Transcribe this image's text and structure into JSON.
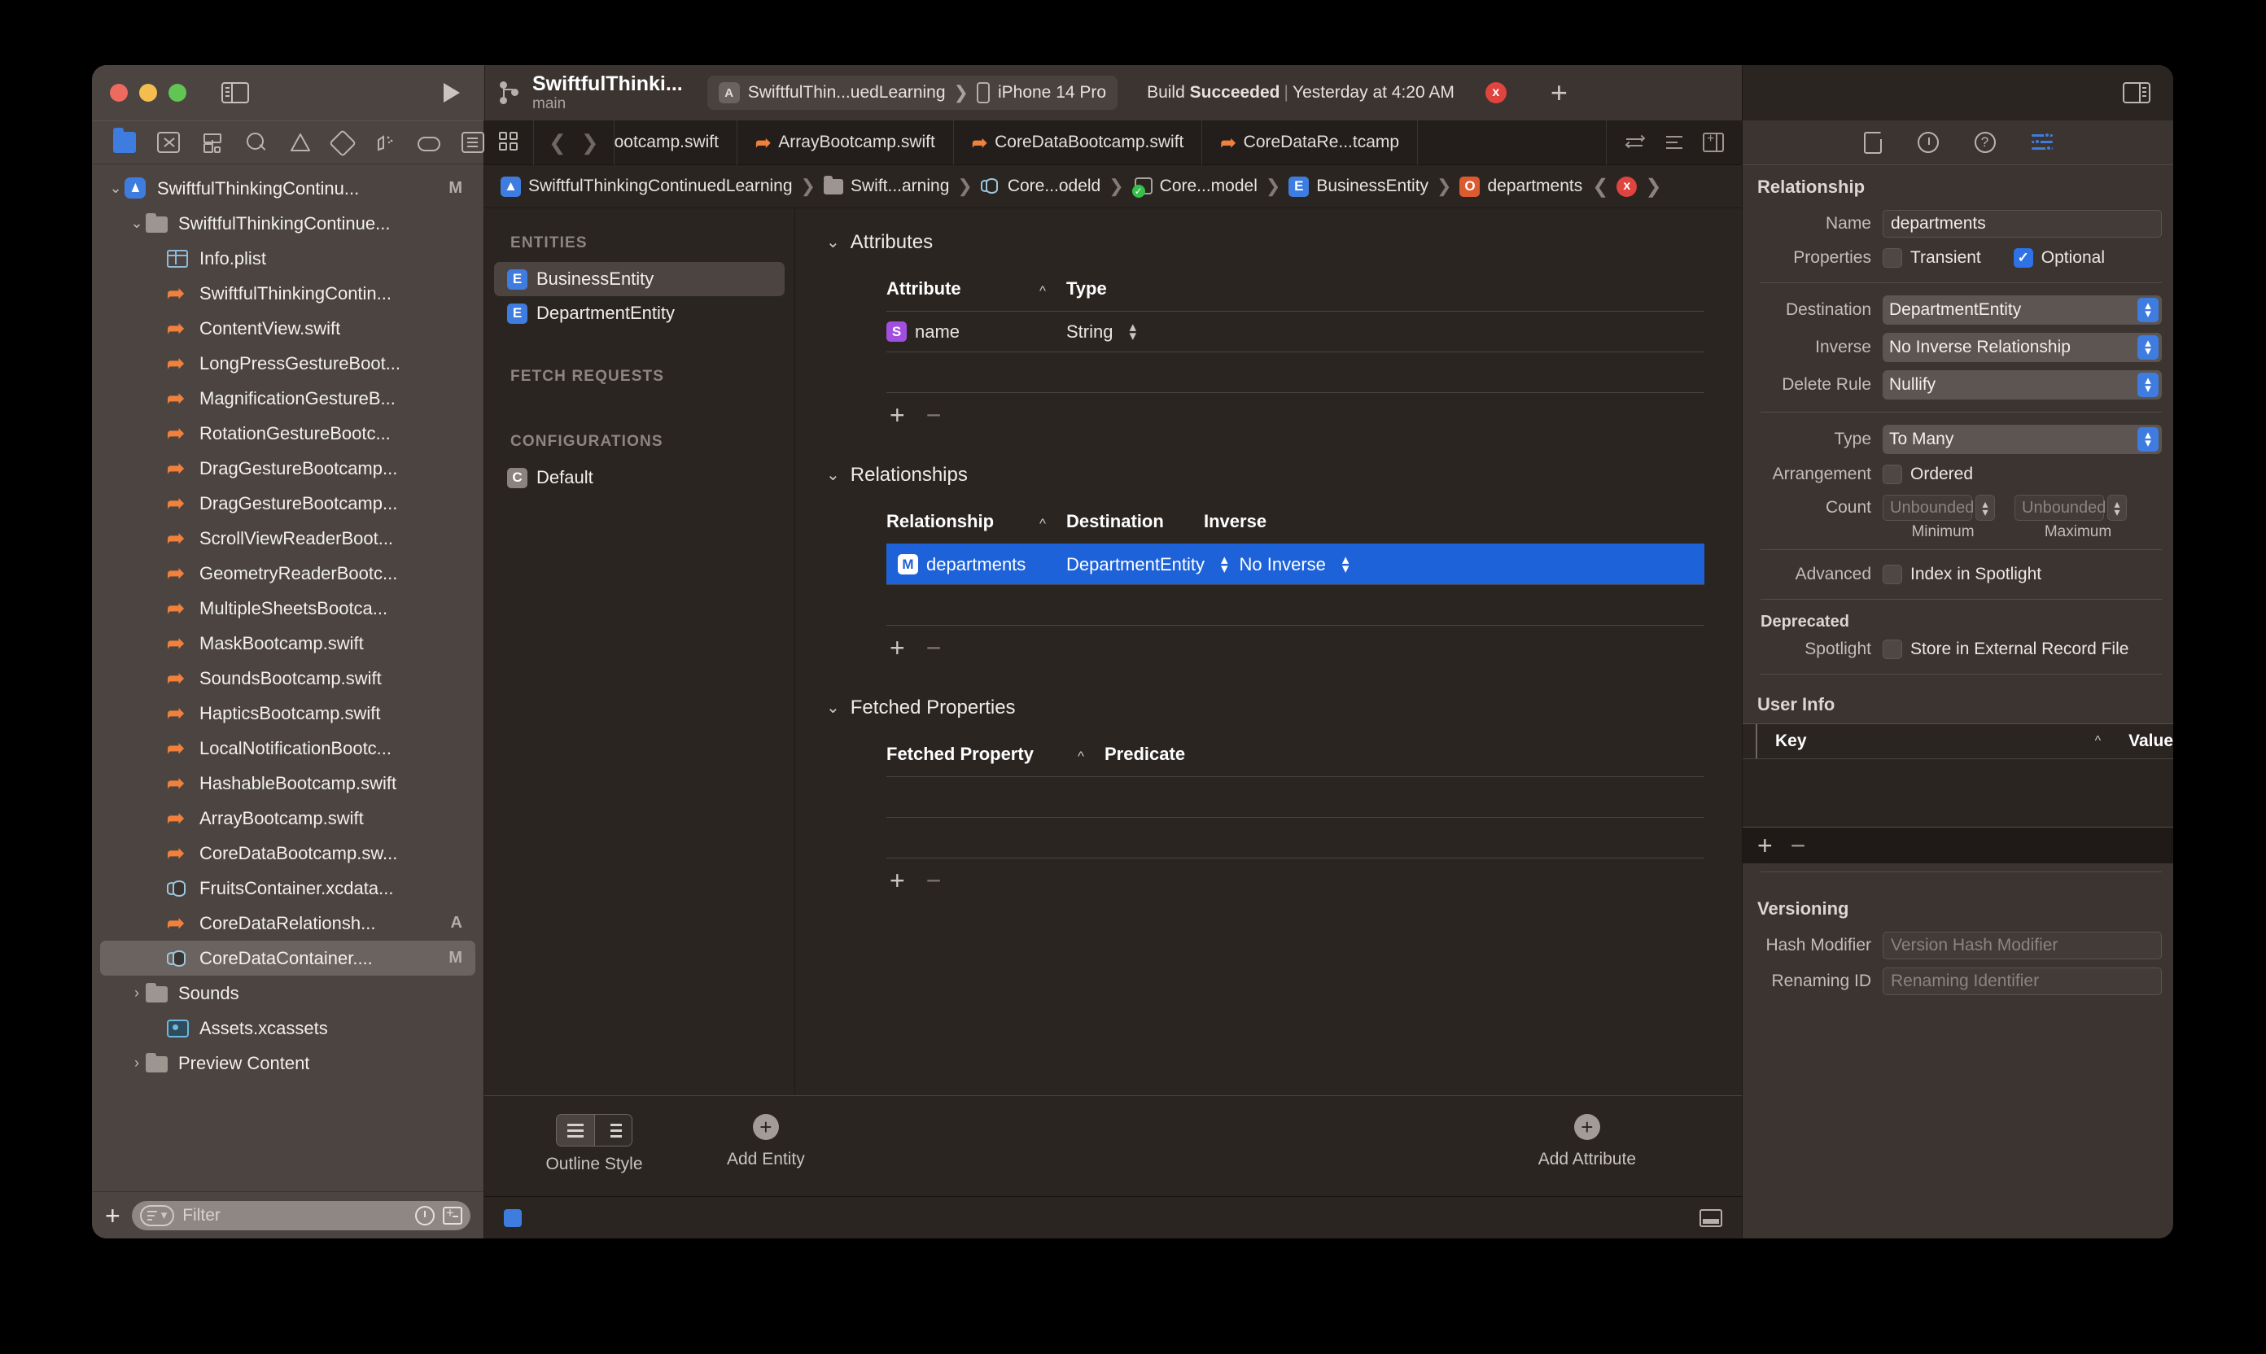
{
  "window": {
    "traffic": [
      "close",
      "minimize",
      "zoom"
    ],
    "sidebar_toggle": "sidebar-toggle",
    "run_button": "run"
  },
  "toolbar": {
    "project_name": "SwiftfulThinki...",
    "branch": "main",
    "scheme": "SwiftfulThin...uedLearning",
    "device": "iPhone 14 Pro",
    "status_prefix": "Build",
    "status_result": "Succeeded",
    "status_separator": "|",
    "status_time": "Yesterday at 4:20 AM",
    "error_count": "x",
    "add_label": "+"
  },
  "navigator": {
    "icons": [
      "folder-icon",
      "source-control-icon",
      "hierarchy-icon",
      "search-icon",
      "warning-icon",
      "test-icon",
      "debug-icon",
      "breakpoint-icon",
      "report-icon"
    ],
    "files": [
      {
        "label": "SwiftfulThinkingContinu...",
        "icon": "app-icon",
        "indent": 0,
        "disclosure": "down",
        "status": "M",
        "selected": false
      },
      {
        "label": "SwiftfulThinkingContinue...",
        "icon": "folder-icon",
        "indent": 1,
        "disclosure": "down",
        "status": "",
        "selected": false
      },
      {
        "label": "Info.plist",
        "icon": "plist-icon",
        "indent": 2,
        "disclosure": "",
        "status": "",
        "selected": false
      },
      {
        "label": "SwiftfulThinkingContin...",
        "icon": "swift-icon",
        "indent": 2,
        "disclosure": "",
        "status": "",
        "selected": false
      },
      {
        "label": "ContentView.swift",
        "icon": "swift-icon",
        "indent": 2,
        "disclosure": "",
        "status": "",
        "selected": false
      },
      {
        "label": "LongPressGestureBoot...",
        "icon": "swift-icon",
        "indent": 2,
        "disclosure": "",
        "status": "",
        "selected": false
      },
      {
        "label": "MagnificationGestureB...",
        "icon": "swift-icon",
        "indent": 2,
        "disclosure": "",
        "status": "",
        "selected": false
      },
      {
        "label": "RotationGestureBootc...",
        "icon": "swift-icon",
        "indent": 2,
        "disclosure": "",
        "status": "",
        "selected": false
      },
      {
        "label": "DragGestureBootcamp...",
        "icon": "swift-icon",
        "indent": 2,
        "disclosure": "",
        "status": "",
        "selected": false
      },
      {
        "label": "DragGestureBootcamp...",
        "icon": "swift-icon",
        "indent": 2,
        "disclosure": "",
        "status": "",
        "selected": false
      },
      {
        "label": "ScrollViewReaderBoot...",
        "icon": "swift-icon",
        "indent": 2,
        "disclosure": "",
        "status": "",
        "selected": false
      },
      {
        "label": "GeometryReaderBootc...",
        "icon": "swift-icon",
        "indent": 2,
        "disclosure": "",
        "status": "",
        "selected": false
      },
      {
        "label": "MultipleSheetsBootca...",
        "icon": "swift-icon",
        "indent": 2,
        "disclosure": "",
        "status": "",
        "selected": false
      },
      {
        "label": "MaskBootcamp.swift",
        "icon": "swift-icon",
        "indent": 2,
        "disclosure": "",
        "status": "",
        "selected": false
      },
      {
        "label": "SoundsBootcamp.swift",
        "icon": "swift-icon",
        "indent": 2,
        "disclosure": "",
        "status": "",
        "selected": false
      },
      {
        "label": "HapticsBootcamp.swift",
        "icon": "swift-icon",
        "indent": 2,
        "disclosure": "",
        "status": "",
        "selected": false
      },
      {
        "label": "LocalNotificationBootc...",
        "icon": "swift-icon",
        "indent": 2,
        "disclosure": "",
        "status": "",
        "selected": false
      },
      {
        "label": "HashableBootcamp.swift",
        "icon": "swift-icon",
        "indent": 2,
        "disclosure": "",
        "status": "",
        "selected": false
      },
      {
        "label": "ArrayBootcamp.swift",
        "icon": "swift-icon",
        "indent": 2,
        "disclosure": "",
        "status": "",
        "selected": false
      },
      {
        "label": "CoreDataBootcamp.sw...",
        "icon": "swift-icon",
        "indent": 2,
        "disclosure": "",
        "status": "",
        "selected": false
      },
      {
        "label": "FruitsContainer.xcdata...",
        "icon": "xcdatamodel-icon",
        "indent": 2,
        "disclosure": "",
        "status": "",
        "selected": false
      },
      {
        "label": "CoreDataRelationsh...",
        "icon": "swift-icon",
        "indent": 2,
        "disclosure": "",
        "status": "A",
        "selected": false
      },
      {
        "label": "CoreDataContainer....",
        "icon": "xcdatamodel-icon",
        "indent": 2,
        "disclosure": "",
        "status": "M",
        "selected": true
      },
      {
        "label": "Sounds",
        "icon": "folder-icon",
        "indent": 1,
        "disclosure": "right",
        "status": "",
        "selected": false
      },
      {
        "label": "Assets.xcassets",
        "icon": "assets-icon",
        "indent": 2,
        "disclosure": "",
        "status": "",
        "selected": false
      },
      {
        "label": "Preview Content",
        "icon": "folder-icon",
        "indent": 1,
        "disclosure": "right",
        "status": "",
        "selected": false
      }
    ],
    "filter_placeholder": "Filter",
    "add_label": "+"
  },
  "tabs": [
    {
      "label": "ootcamp.swift",
      "icon": "",
      "truncated": true
    },
    {
      "label": "ArrayBootcamp.swift",
      "icon": "swift-icon",
      "truncated": false
    },
    {
      "label": "CoreDataBootcamp.swift",
      "icon": "swift-icon",
      "truncated": false
    },
    {
      "label": "CoreDataRe...tcamp",
      "icon": "swift-icon",
      "truncated": false
    }
  ],
  "breadcrumb": [
    {
      "label": "SwiftfulThinkingContinuedLearning",
      "icon": "app-icon"
    },
    {
      "label": "Swift...arning",
      "icon": "folder-icon"
    },
    {
      "label": "Core...odeld",
      "icon": "xcdatamodel-icon"
    },
    {
      "label": "Core...model",
      "icon": "model-icon"
    },
    {
      "label": "BusinessEntity",
      "icon": "entity-badge"
    },
    {
      "label": "departments",
      "icon": "relationship-badge"
    }
  ],
  "entities_pane": {
    "entities_header": "ENTITIES",
    "entities": [
      {
        "label": "BusinessEntity",
        "badge": "E",
        "selected": true
      },
      {
        "label": "DepartmentEntity",
        "badge": "E",
        "selected": false
      }
    ],
    "fetch_requests_header": "FETCH REQUESTS",
    "fetch_requests": [],
    "configurations_header": "CONFIGURATIONS",
    "configurations": [
      {
        "label": "Default",
        "badge": "C",
        "selected": false
      }
    ]
  },
  "attributes_section": {
    "title": "Attributes",
    "columns": [
      "Attribute",
      "Type"
    ],
    "rows": [
      {
        "badge": "S",
        "name": "name",
        "type": "String"
      }
    ],
    "add_label": "+",
    "remove_label": "−"
  },
  "relationships_section": {
    "title": "Relationships",
    "columns": [
      "Relationship",
      "Destination",
      "Inverse"
    ],
    "rows": [
      {
        "badge": "M",
        "name": "departments",
        "destination": "DepartmentEntity",
        "inverse": "No Inverse",
        "selected": true
      }
    ],
    "add_label": "+",
    "remove_label": "−"
  },
  "fetched_properties_section": {
    "title": "Fetched Properties",
    "columns": [
      "Fetched Property",
      "Predicate"
    ],
    "rows": [],
    "add_label": "+",
    "remove_label": "−"
  },
  "editor_bottom": {
    "outline_style_label": "Outline Style",
    "add_entity_label": "Add Entity",
    "add_attribute_label": "Add Attribute"
  },
  "inspector": {
    "icons": [
      "file-inspector-icon",
      "history-inspector-icon",
      "help-inspector-icon",
      "attributes-inspector-icon"
    ],
    "section_title": "Relationship",
    "name_label": "Name",
    "name_value": "departments",
    "properties_label": "Properties",
    "transient_label": "Transient",
    "transient_checked": false,
    "optional_label": "Optional",
    "optional_checked": true,
    "destination_label": "Destination",
    "destination_value": "DepartmentEntity",
    "inverse_label": "Inverse",
    "inverse_value": "No Inverse Relationship",
    "delete_rule_label": "Delete Rule",
    "delete_rule_value": "Nullify",
    "type_label": "Type",
    "type_value": "To Many",
    "arrangement_label": "Arrangement",
    "ordered_label": "Ordered",
    "ordered_checked": false,
    "count_label": "Count",
    "count_min_placeholder": "Unbounded",
    "count_max_placeholder": "Unbounded",
    "count_min_caption": "Minimum",
    "count_max_caption": "Maximum",
    "advanced_label": "Advanced",
    "index_spotlight_label": "Index in Spotlight",
    "index_spotlight_checked": false,
    "deprecated_label": "Deprecated",
    "spotlight_label": "Spotlight",
    "store_external_label": "Store in External Record File",
    "store_external_checked": false,
    "user_info_title": "User Info",
    "user_info_columns": [
      "Key",
      "Value"
    ],
    "user_info_rows": [],
    "user_info_add": "+",
    "user_info_remove": "−",
    "versioning_title": "Versioning",
    "hash_modifier_label": "Hash Modifier",
    "hash_modifier_placeholder": "Version Hash Modifier",
    "renaming_id_label": "Renaming ID",
    "renaming_id_placeholder": "Renaming Identifier"
  },
  "colors": {
    "accent_blue": "#3f7ce0",
    "selection_blue": "#1d62d8",
    "swift_orange": "#f0813c",
    "error_red": "#e0443e",
    "success_green": "#34c04a",
    "attribute_purple": "#a24fe0"
  }
}
